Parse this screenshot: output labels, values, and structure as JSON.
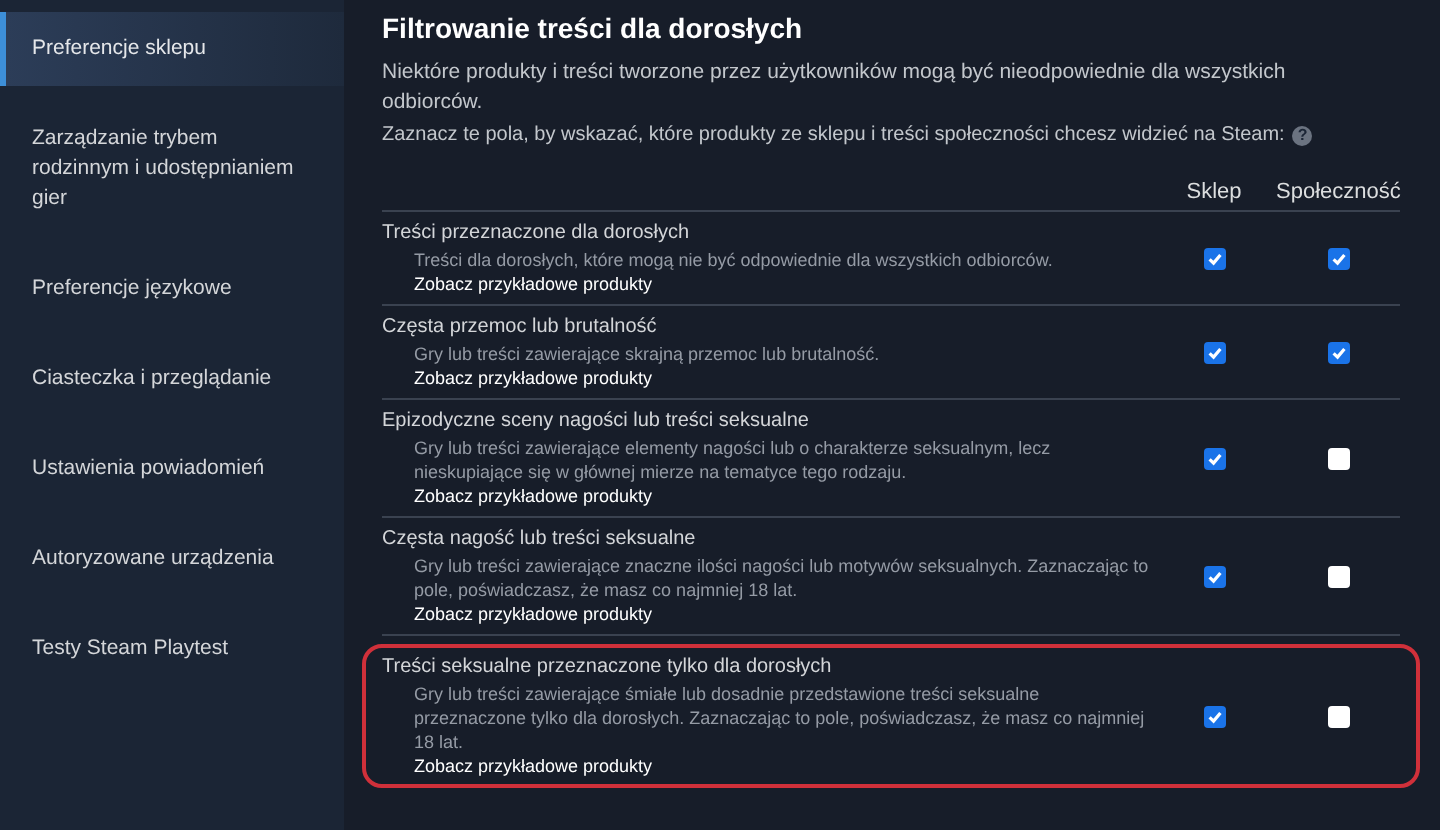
{
  "sidebar": {
    "items": [
      {
        "label": "Preferencje sklepu",
        "selected": true
      },
      {
        "label": "Zarządzanie trybem rodzinnym i udostępnianiem gier",
        "selected": false
      },
      {
        "label": "Preferencje językowe",
        "selected": false
      },
      {
        "label": "Ciasteczka i przeglądanie",
        "selected": false
      },
      {
        "label": "Ustawienia powiadomień",
        "selected": false
      },
      {
        "label": "Autoryzowane urządzenia",
        "selected": false
      },
      {
        "label": "Testy Steam Playtest",
        "selected": false
      }
    ]
  },
  "section": {
    "title": "Filtrowanie treści dla dorosłych",
    "intro": "Niektóre produkty i treści tworzone przez użytkowników mogą być nieodpowiednie dla wszystkich odbiorców.",
    "instruction": "Zaznacz te pola, by wskazać, które produkty ze sklepu i treści społeczności chcesz widzieć na Steam:",
    "help_icon": "?"
  },
  "columns": [
    "Sklep",
    "Społeczność"
  ],
  "rows": [
    {
      "title": "Treści przeznaczone dla dorosłych",
      "description": "Treści dla dorosłych, które mogą nie być odpowiednie dla wszystkich odbiorców.",
      "link": "Zobacz przykładowe produkty",
      "store": true,
      "community": true,
      "highlighted": false
    },
    {
      "title": "Częsta przemoc lub brutalność",
      "description": "Gry lub treści zawierające skrajną przemoc lub brutalność.",
      "link": "Zobacz przykładowe produkty",
      "store": true,
      "community": true,
      "highlighted": false
    },
    {
      "title": "Epizodyczne sceny nagości lub treści seksualne",
      "description": "Gry lub treści zawierające elementy nagości lub o charakterze seksualnym, lecz nieskupiające się w głównej mierze na tematyce tego rodzaju.",
      "link": "Zobacz przykładowe produkty",
      "store": true,
      "community": false,
      "highlighted": false
    },
    {
      "title": "Częsta nagość lub treści seksualne",
      "description": "Gry lub treści zawierające znaczne ilości nagości lub motywów seksualnych. Zaznaczając to pole, poświadczasz, że masz co najmniej 18 lat.",
      "link": "Zobacz przykładowe produkty",
      "store": true,
      "community": false,
      "highlighted": false
    },
    {
      "title": "Treści seksualne przeznaczone tylko dla dorosłych",
      "description": "Gry lub treści zawierające śmiałe lub dosadnie przedstawione treści seksualne przeznaczone tylko dla dorosłych. Zaznaczając to pole, poświadczasz, że masz co najmniej 18 lat.",
      "link": "Zobacz przykładowe produkty",
      "store": true,
      "community": false,
      "highlighted": true
    }
  ]
}
